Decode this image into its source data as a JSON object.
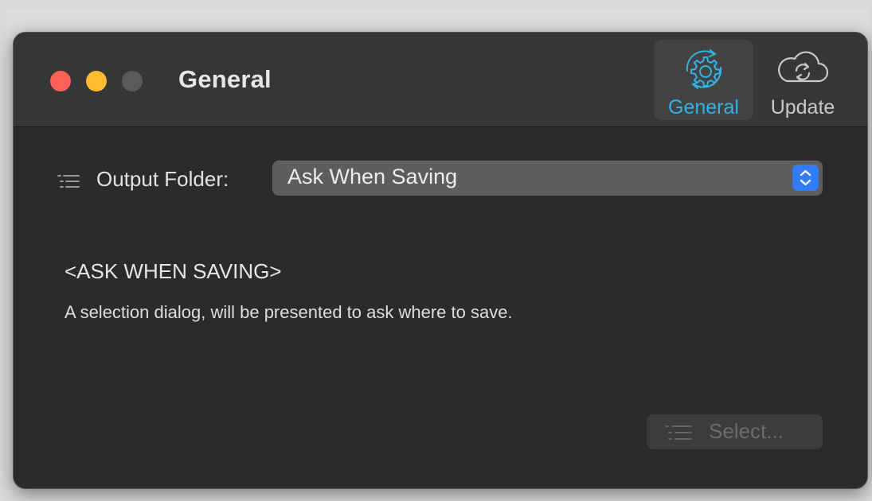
{
  "window": {
    "title": "General"
  },
  "toolbar": {
    "items": [
      {
        "label": "General",
        "icon": "gear-icon",
        "selected": true
      },
      {
        "label": "Update",
        "icon": "cloud-sync-icon",
        "selected": false
      }
    ]
  },
  "output_folder": {
    "label": "Output Folder:",
    "selected_value": "Ask When Saving"
  },
  "info": {
    "heading": "<ASK WHEN SAVING>",
    "description": "A selection dialog, will be presented to ask where to save."
  },
  "select_button": {
    "label": "Select...",
    "enabled": false
  },
  "colors": {
    "accent": "#2fb4e8",
    "close": "#fe5f57",
    "minimize": "#febc2e",
    "stepper": "#2f7cf6"
  }
}
